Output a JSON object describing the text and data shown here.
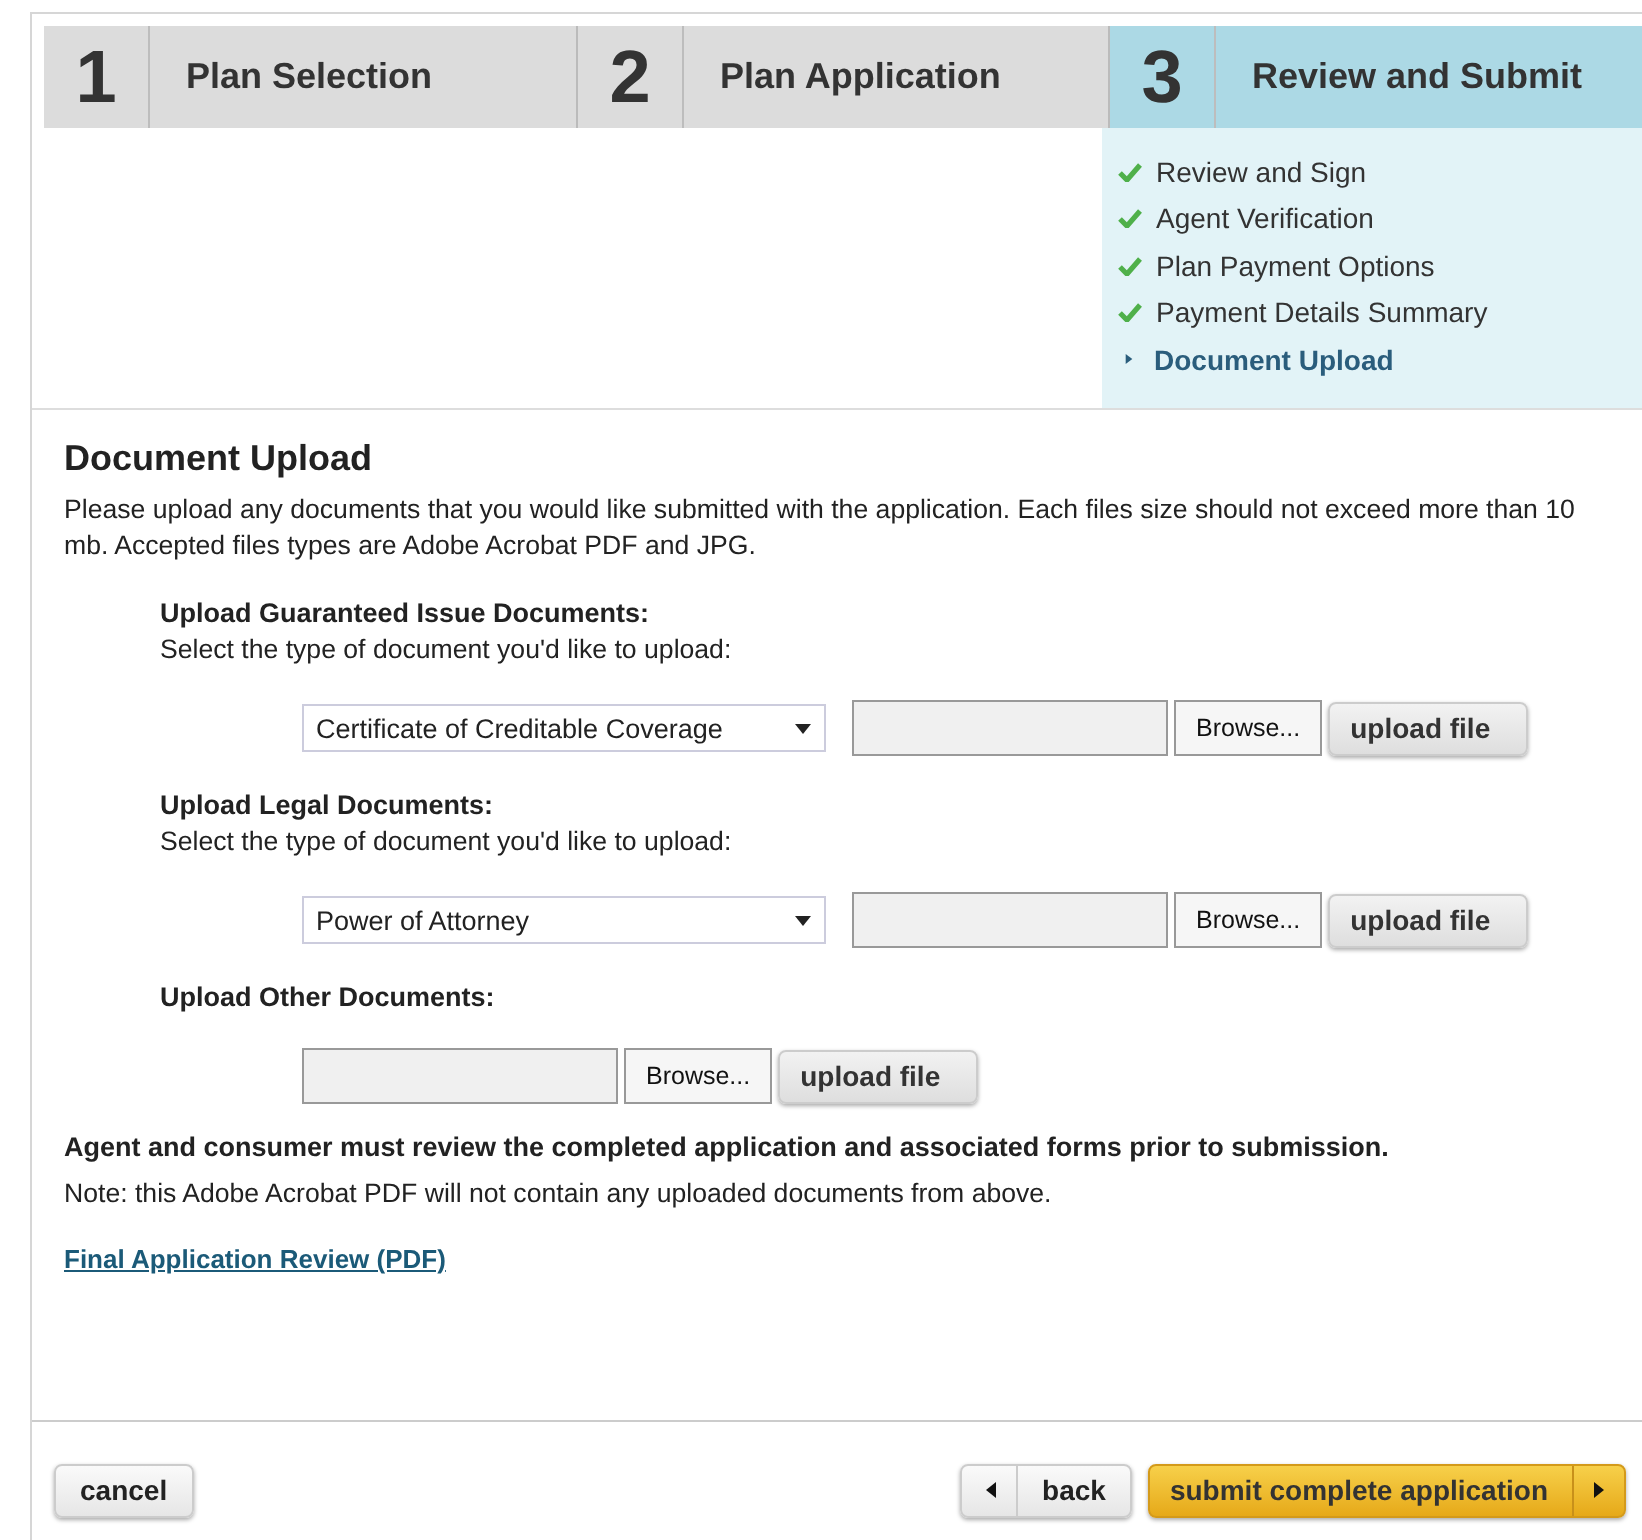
{
  "steps": [
    {
      "number": "1",
      "label": "Plan Selection",
      "selected": false
    },
    {
      "number": "2",
      "label": "Plan Application",
      "selected": false
    },
    {
      "number": "3",
      "label": "Review and Submit",
      "selected": true
    }
  ],
  "substeps": [
    {
      "label": "Review and Sign",
      "done": true
    },
    {
      "label": "Agent Verification",
      "done": true
    },
    {
      "label": "Plan Payment Options",
      "done": true
    },
    {
      "label": "Payment Details Summary",
      "done": true
    },
    {
      "label": "Document Upload",
      "done": false
    }
  ],
  "section": {
    "title": "Document Upload",
    "description": "Please upload any documents that you would like submitted with the application. Each files size should not exceed more than 10 mb. Accepted files types are Adobe Acrobat PDF and JPG."
  },
  "upload_groups": [
    {
      "kind": "select",
      "heading": "Upload Guaranteed Issue Documents:",
      "instruction": "Select the type of document you'd like to upload:",
      "document_type": "Certificate of Creditable Coverage",
      "browse": "Browse...",
      "upload": "upload file"
    },
    {
      "kind": "select",
      "heading": "Upload Legal Documents:",
      "instruction": "Select the type of document you'd like to upload:",
      "document_type": "Power of Attorney",
      "browse": "Browse...",
      "upload": "upload file"
    },
    {
      "kind": "plain",
      "heading": "Upload Other Documents:",
      "browse": "Browse...",
      "upload": "upload file"
    }
  ],
  "notice": "Agent and consumer must review the completed application and associated forms prior to submission.",
  "note": "Note: this Adobe Acrobat PDF will not contain any uploaded documents from above.",
  "review_link": "Final Application Review (PDF)",
  "footer": {
    "cancel": "cancel",
    "back": "back",
    "submit": "submit complete application"
  }
}
